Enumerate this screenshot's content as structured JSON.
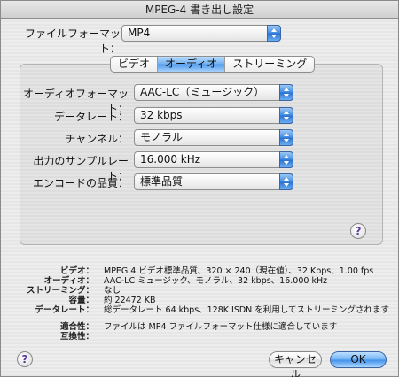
{
  "window": {
    "title": "MPEG-4 書き出し設定"
  },
  "file_format": {
    "label": "ファイルフォーマット：",
    "value": "MP4"
  },
  "tabs": [
    {
      "label": "ビデオ",
      "active": false
    },
    {
      "label": "オーディオ",
      "active": true
    },
    {
      "label": "ストリーミング",
      "active": false
    }
  ],
  "audio": {
    "format": {
      "label": "オーディオフォーマット：",
      "value": "AAC-LC（ミュージック）"
    },
    "data_rate": {
      "label": "データレート：",
      "value": "32 kbps"
    },
    "channels": {
      "label": "チャンネル：",
      "value": "モノラル"
    },
    "sample_rate": {
      "label": "出力のサンプルレート：",
      "value": "16.000 kHz"
    },
    "encode_quality": {
      "label": "エンコードの品質：",
      "value": "標準品質"
    }
  },
  "summary": {
    "video_label": "ビデオ：",
    "video_value": "MPEG 4 ビデオ標準品質、320 × 240（現在値）、32 Kbps、1.00 fps",
    "audio_label": "オーディオ：",
    "audio_value": "AAC-LC ミュージック、モノラル、32 kbps、16.000 kHz",
    "streaming_label": "ストリーミング：",
    "streaming_value": "なし",
    "size_label": "容量：",
    "size_value": "約 22472 KB",
    "datarate_label": "データレート：",
    "datarate_value": "総データレート 64 kbps、128K ISDN を利用してストリーミングされます",
    "compat_label": "適合性：",
    "compat_value": "ファイルは MP4 ファイルフォーマット仕様に適合しています",
    "interop_label": "互換性："
  },
  "buttons": {
    "help": "?",
    "cancel": "キャンセル",
    "ok": "OK"
  }
}
